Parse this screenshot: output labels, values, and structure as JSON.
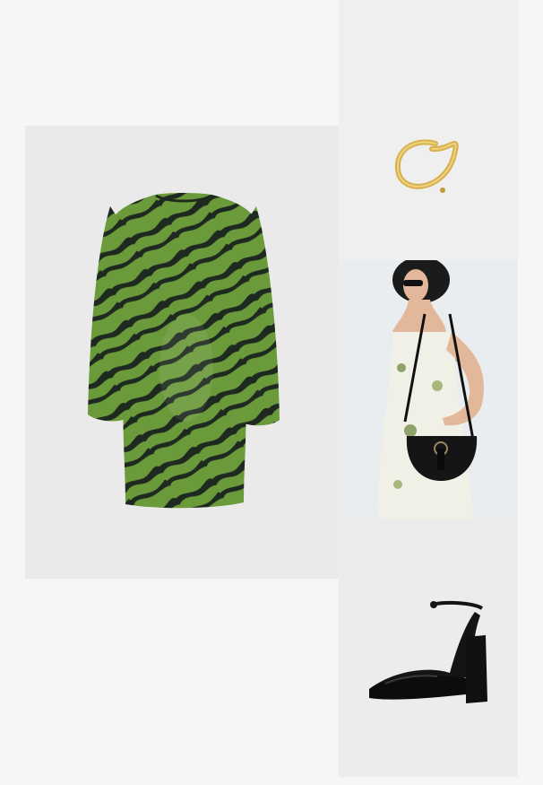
{
  "outfit": {
    "items": [
      {
        "product": "dress",
        "icon": "sequin-zebra-dress",
        "colors": {
          "primary": "#5f8f34",
          "secondary": "#1f2a22"
        }
      },
      {
        "product": "earring",
        "icon": "gold-hoop-earring",
        "colors": {
          "primary": "#d8b050"
        }
      },
      {
        "product": "bag",
        "icon": "black-saddle-bag-on-model",
        "colors": {
          "primary": "#151515",
          "dress": "#f1f0e6"
        }
      },
      {
        "product": "shoe",
        "icon": "black-platform-heel",
        "colors": {
          "primary": "#141414"
        }
      }
    ]
  }
}
